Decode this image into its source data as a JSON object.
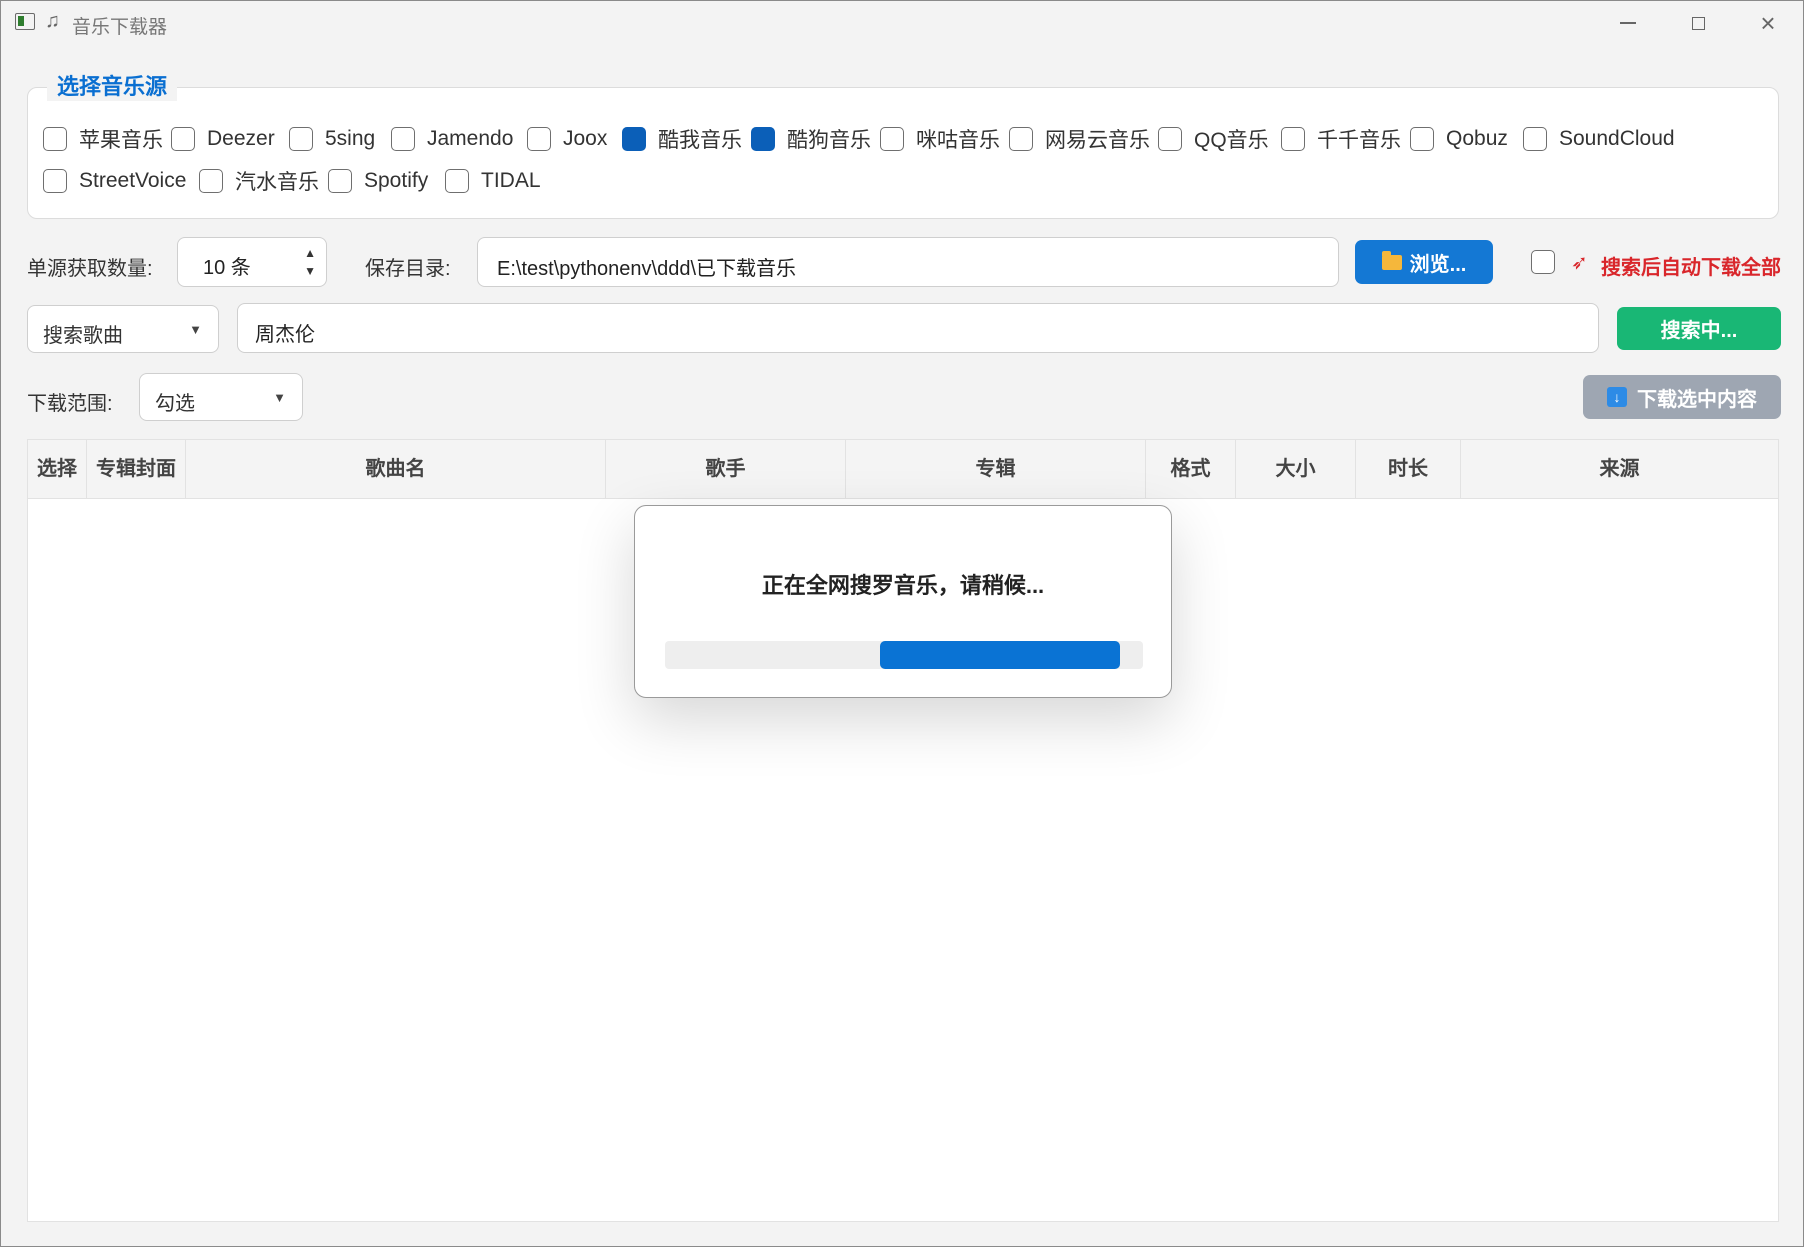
{
  "window": {
    "title": "音乐下载器",
    "title_icon": "music-note-icon"
  },
  "sources": {
    "legend": "选择音乐源",
    "items": [
      {
        "label": "苹果音乐",
        "checked": false
      },
      {
        "label": "Deezer",
        "checked": false
      },
      {
        "label": "5sing",
        "checked": false
      },
      {
        "label": "Jamendo",
        "checked": false
      },
      {
        "label": "Joox",
        "checked": false
      },
      {
        "label": "酷我音乐",
        "checked": true
      },
      {
        "label": "酷狗音乐",
        "checked": true
      },
      {
        "label": "咪咕音乐",
        "checked": false
      },
      {
        "label": "网易云音乐",
        "checked": false
      },
      {
        "label": "QQ音乐",
        "checked": false
      },
      {
        "label": "千千音乐",
        "checked": false
      },
      {
        "label": "Qobuz",
        "checked": false
      },
      {
        "label": "SoundCloud",
        "checked": false
      },
      {
        "label": "StreetVoice",
        "checked": false
      },
      {
        "label": "汽水音乐",
        "checked": false
      },
      {
        "label": "Spotify",
        "checked": false
      },
      {
        "label": "TIDAL",
        "checked": false
      }
    ]
  },
  "options": {
    "count_label": "单源获取数量:",
    "count_value": "10 条",
    "save_dir_label": "保存目录:",
    "save_dir_value": "E:\\test\\pythonenv\\ddd\\已下载音乐",
    "browse_label": "浏览...",
    "auto_download_label": "搜索后自动下载全部",
    "auto_download_checked": false
  },
  "search": {
    "mode": "搜索歌曲",
    "query": "周杰伦",
    "button_label": "搜索中..."
  },
  "download": {
    "range_label": "下载范围:",
    "range_value": "勾选",
    "button_label": "下载选中内容"
  },
  "table": {
    "columns": [
      "选择",
      "专辑封面",
      "歌曲名",
      "歌手",
      "专辑",
      "格式",
      "大小",
      "时长",
      "来源"
    ],
    "rows": []
  },
  "dialog": {
    "message": "正在全网搜罗音乐，请稍候...",
    "progress": "indeterminate"
  },
  "colors": {
    "accent": "#0a6fd1",
    "browse_button": "#1478d4",
    "search_button": "#19b775",
    "download_button_disabled": "#9ea6b2",
    "checkbox_checked": "#0b5fb8",
    "warning_text": "#d9262b"
  }
}
